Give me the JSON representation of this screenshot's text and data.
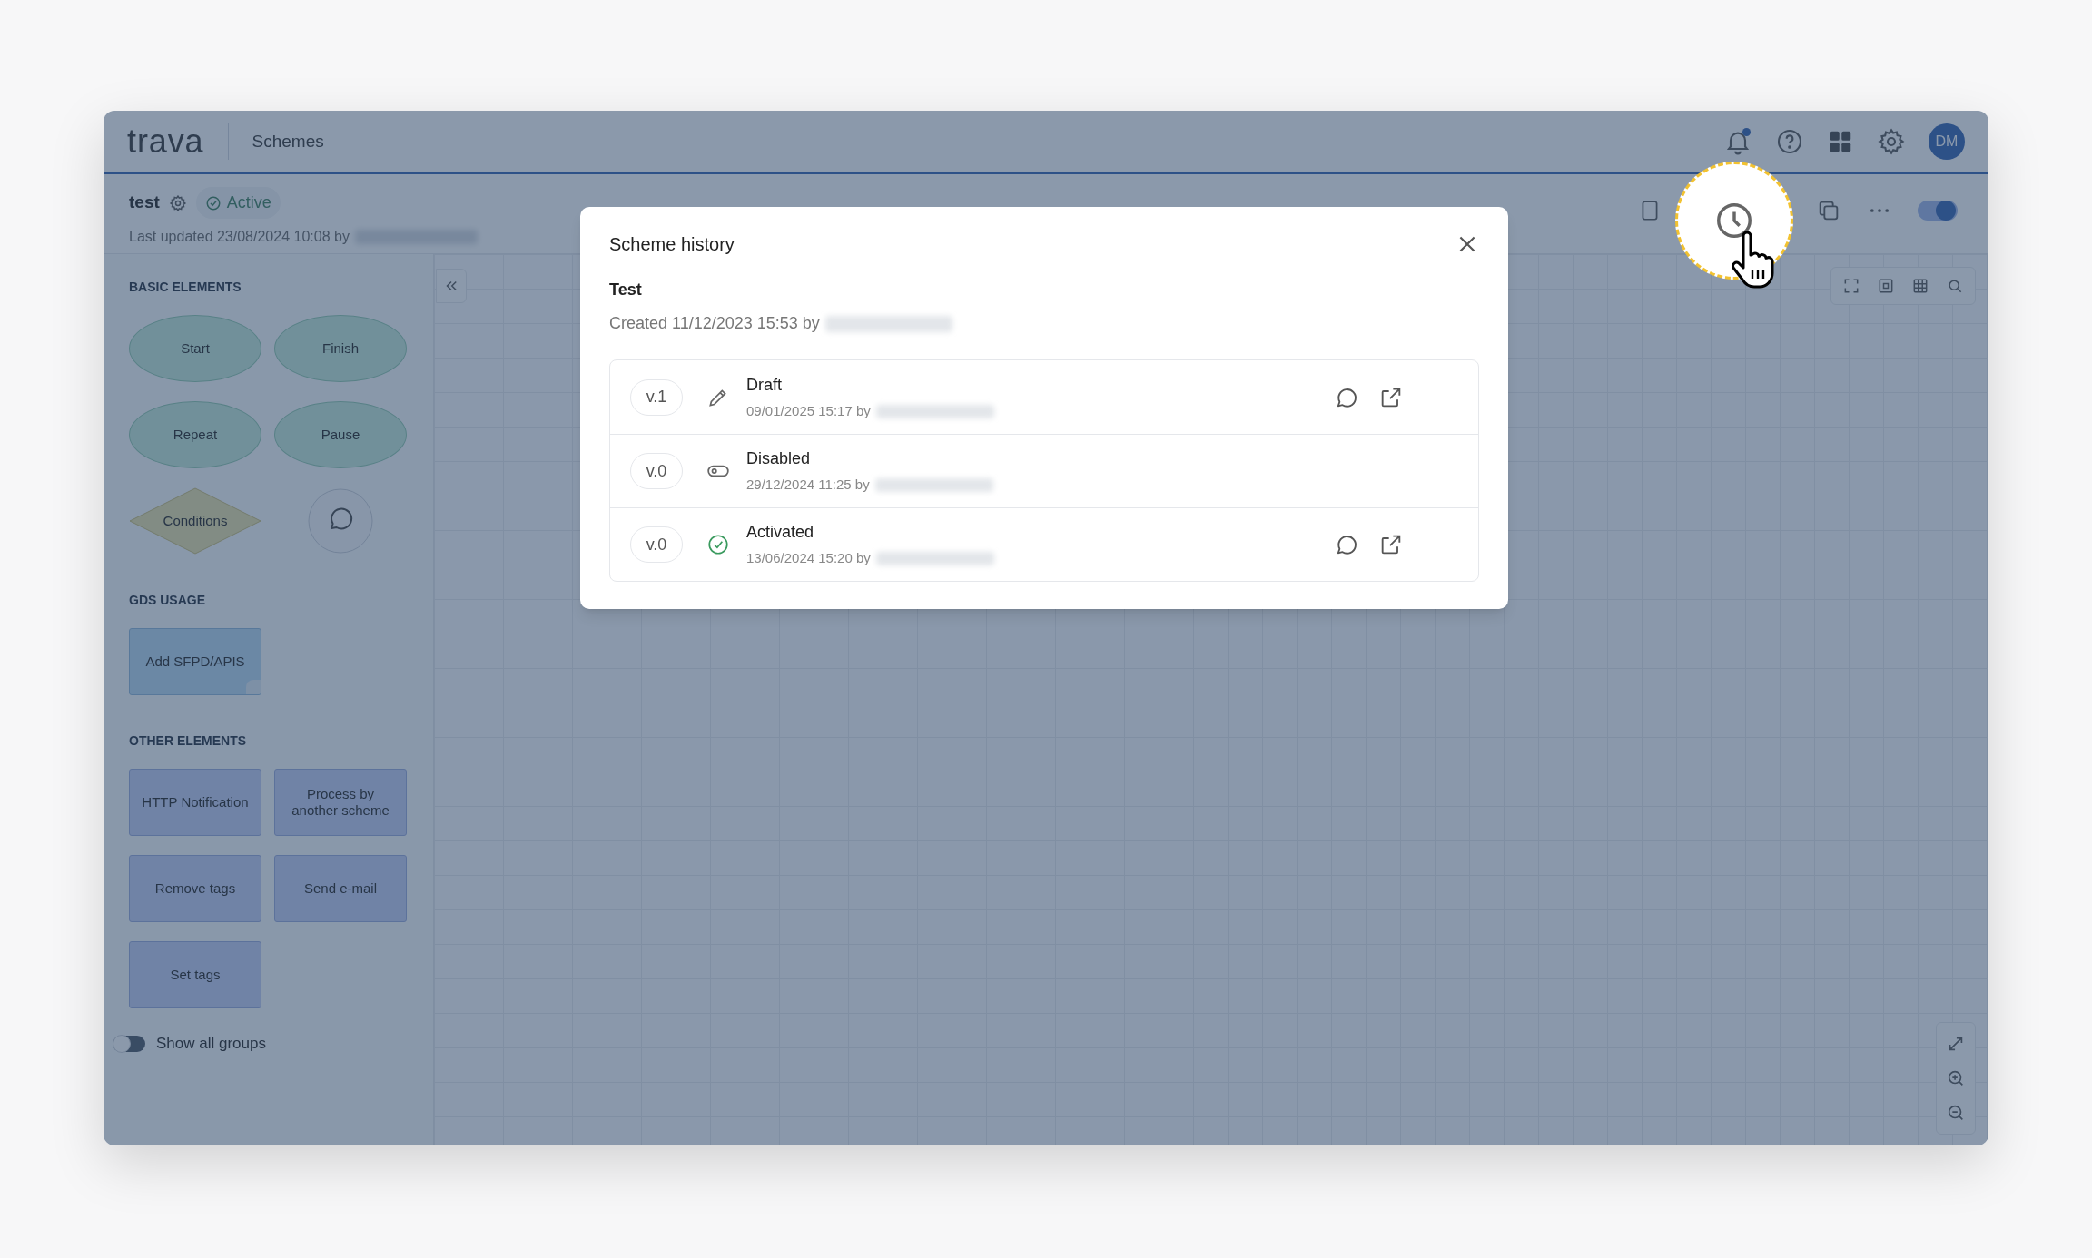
{
  "header": {
    "logo": "trava",
    "section": "Schemes",
    "has_unread": true,
    "avatar": "DM"
  },
  "scheme": {
    "name": "test",
    "status": "Active",
    "last_updated": "Last updated 23/08/2024 10:08 by",
    "enabled": true
  },
  "sidebar": {
    "groups": [
      {
        "title": "BASIC ELEMENTS",
        "items": [
          {
            "kind": "ellipse",
            "label": "Start"
          },
          {
            "kind": "ellipse",
            "label": "Finish"
          },
          {
            "kind": "ellipse",
            "label": "Repeat"
          },
          {
            "kind": "ellipse",
            "label": "Pause"
          },
          {
            "kind": "diamond",
            "label": "Conditions"
          },
          {
            "kind": "comment"
          }
        ]
      },
      {
        "title": "GDS USAGE",
        "items": [
          {
            "kind": "document",
            "label": "Add SFPD/APIS"
          }
        ]
      },
      {
        "title": "OTHER ELEMENTS",
        "items": [
          {
            "kind": "box",
            "label": "HTTP Notification"
          },
          {
            "kind": "box",
            "label": "Process by another scheme"
          },
          {
            "kind": "box",
            "label": "Remove tags"
          },
          {
            "kind": "box",
            "label": "Send e-mail"
          },
          {
            "kind": "box",
            "label": "Set tags"
          }
        ]
      }
    ],
    "show_all_groups": {
      "label": "Show all groups",
      "on": false
    }
  },
  "modal": {
    "title": "Scheme history",
    "scheme_name": "Test",
    "created": "Created 11/12/2023 15:53 by",
    "versions": [
      {
        "version": "v.1",
        "kind": "draft",
        "status": "Draft",
        "time": "09/01/2025 15:17 by",
        "has_actions": true
      },
      {
        "version": "v.0",
        "kind": "disabled",
        "status": "Disabled",
        "time": "29/12/2024 11:25 by",
        "has_actions": false
      },
      {
        "version": "v.0",
        "kind": "activated",
        "status": "Activated",
        "time": "13/06/2024 15:20 by",
        "has_actions": true
      }
    ]
  }
}
